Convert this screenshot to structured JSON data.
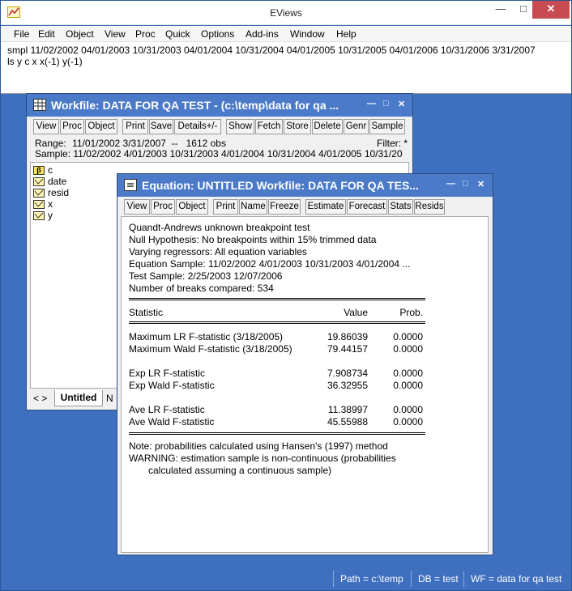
{
  "app": {
    "title": "EViews",
    "menu": [
      "File",
      "Edit",
      "Object",
      "View",
      "Proc",
      "Quick",
      "Options",
      "Add-ins",
      "Window",
      "Help"
    ],
    "command_lines": [
      "smpl 11/02/2002 04/01/2003 10/31/2003 04/01/2004 10/31/2004 04/01/2005 10/31/2005 04/01/2006 10/31/2006 3/31/2007",
      "ls y c x x(-1) y(-1)"
    ],
    "status": {
      "path": "Path = c:\\temp",
      "db": "DB = test",
      "wf": "WF = data for qa test"
    }
  },
  "workfile": {
    "title": "Workfile: DATA FOR QA TEST - (c:\\temp\\data for qa ...",
    "toolbar": [
      "View",
      "Proc",
      "Object",
      "Print",
      "Save",
      "Details+/-",
      "Show",
      "Fetch",
      "Store",
      "Delete",
      "Genr",
      "Sample"
    ],
    "range_label": "Range:",
    "range_value": "11/01/2002 3/31/2007  --   1612 obs",
    "filter": "Filter: *",
    "sample_label": "Sample:",
    "sample_value": "11/02/2002 4/01/2003 10/31/2003 4/01/2004 10/31/2004 4/01/2005 10/31/20",
    "objects": [
      {
        "name": "c",
        "icon": "coef-icon"
      },
      {
        "name": "date",
        "icon": "series-icon"
      },
      {
        "name": "resid",
        "icon": "series-icon"
      },
      {
        "name": "x",
        "icon": "series-icon"
      },
      {
        "name": "y",
        "icon": "series-icon"
      }
    ],
    "tab_nav": "< >",
    "tab_active": "Untitled",
    "tab_new": "N"
  },
  "equation": {
    "title": "Equation: UNTITLED   Workfile: DATA FOR QA TES...",
    "toolbar": [
      "View",
      "Proc",
      "Object",
      "Print",
      "Name",
      "Freeze",
      "Estimate",
      "Forecast",
      "Stats",
      "Resids"
    ],
    "header_lines": [
      "Quandt-Andrews unknown breakpoint test",
      "Null Hypothesis: No breakpoints within 15% trimmed data",
      "Varying regressors: All equation variables",
      "Equation Sample: 11/02/2002 4/01/2003 10/31/2003 4/01/2004 ...",
      "Test Sample: 2/25/2003 12/07/2006",
      "Number of breaks compared: 534"
    ],
    "columns": [
      "Statistic",
      "Value",
      "Prob."
    ],
    "rows": [
      {
        "stat": "Maximum LR F-statistic (3/18/2005)",
        "value": "19.86039",
        "prob": "0.0000"
      },
      {
        "stat": "Maximum Wald F-statistic (3/18/2005)",
        "value": "79.44157",
        "prob": "0.0000"
      },
      {
        "stat": "Exp LR F-statistic",
        "value": "7.908734",
        "prob": "0.0000"
      },
      {
        "stat": "Exp Wald F-statistic",
        "value": "36.32955",
        "prob": "0.0000"
      },
      {
        "stat": "Ave LR F-statistic",
        "value": "11.38997",
        "prob": "0.0000"
      },
      {
        "stat": "Ave Wald F-statistic",
        "value": "45.55988",
        "prob": "0.0000"
      }
    ],
    "notes": [
      "Note: probabilities calculated using Hansen's (1997) method",
      "WARNING: estimation sample is non-continuous (probabilities",
      "calculated assuming a continuous sample)"
    ]
  },
  "colors": {
    "desktop": "#3f6fbf",
    "child_title": "#4a7ac8",
    "close": "#c74b50"
  }
}
